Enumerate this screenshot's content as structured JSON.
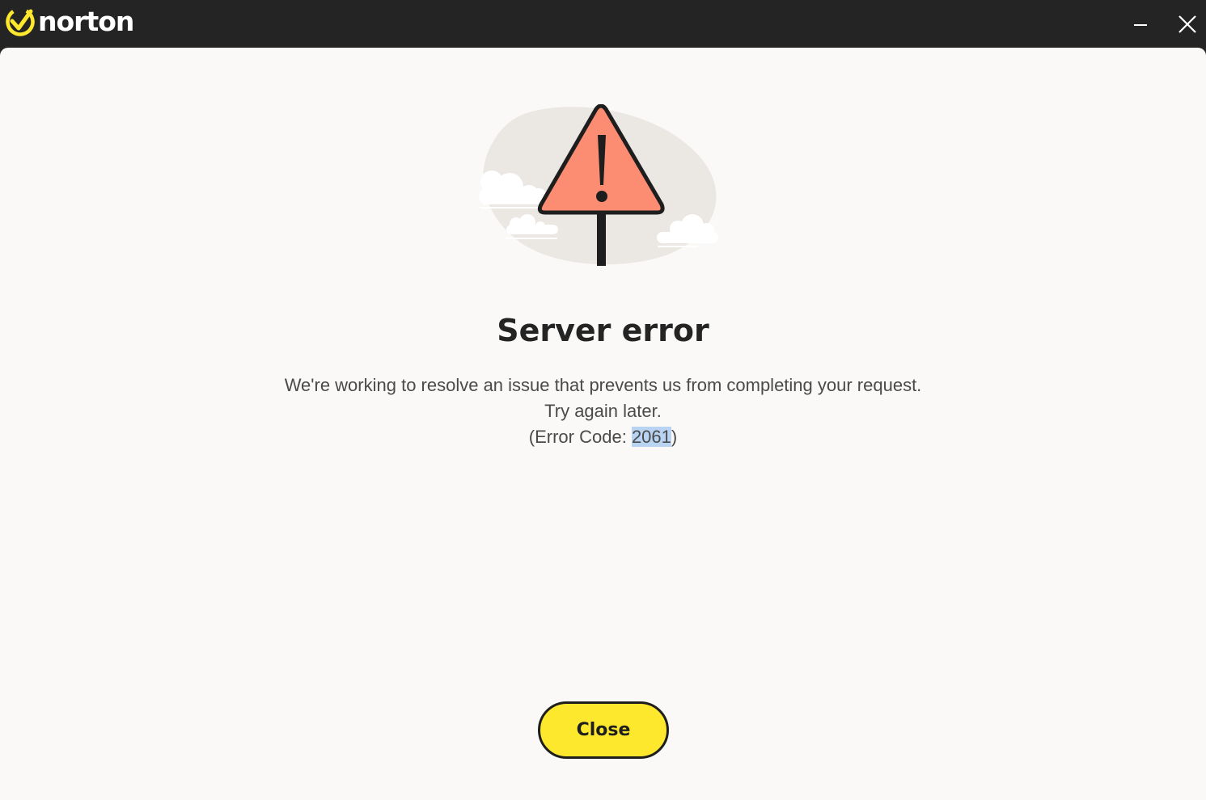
{
  "app": {
    "brand": "norton",
    "brand_color": "#fde82e"
  },
  "window_controls": {
    "minimize_icon": "minimize-icon",
    "close_icon": "close-icon"
  },
  "illustration": {
    "icon": "warning-sign-icon",
    "sign_color": "#fc8c72"
  },
  "dialog": {
    "title": "Server error",
    "message_line1": "We're working to resolve an issue that prevents us from completing your request.",
    "message_line2": "Try again later.",
    "error_prefix": "(Error Code: ",
    "error_code": "2061",
    "error_suffix": ")",
    "close_label": "Close"
  }
}
